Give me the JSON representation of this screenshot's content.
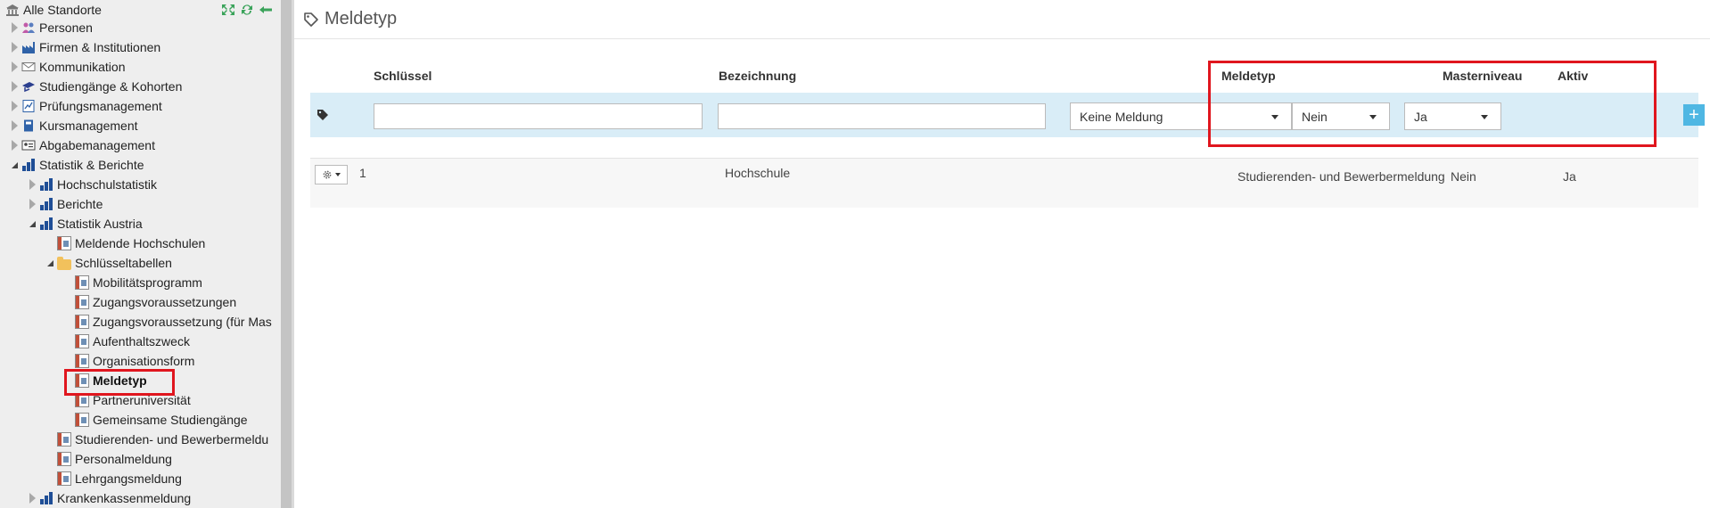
{
  "sidebar": {
    "root": {
      "label": "Alle Standorte",
      "icon": "building-icon"
    },
    "toolbar": [
      {
        "icon": "expand-icon",
        "color": "#3aa35a"
      },
      {
        "icon": "refresh-icon",
        "color": "#3aa35a"
      },
      {
        "icon": "collapse-icon",
        "color": "#3aa35a"
      }
    ],
    "items": [
      {
        "label": "Personen",
        "icon": "people-icon",
        "state": "closed",
        "level": 0
      },
      {
        "label": "Firmen & Institutionen",
        "icon": "factory-icon",
        "state": "closed",
        "level": 0
      },
      {
        "label": "Kommunikation",
        "icon": "envelope-icon",
        "state": "closed",
        "level": 0
      },
      {
        "label": "Studiengänge & Kohorten",
        "icon": "graduation-icon",
        "state": "closed",
        "level": 0
      },
      {
        "label": "Prüfungsmanagement",
        "icon": "chart-paper-icon",
        "state": "closed",
        "level": 0
      },
      {
        "label": "Kursmanagement",
        "icon": "book-icon",
        "state": "closed",
        "level": 0
      },
      {
        "label": "Abgabemanagement",
        "icon": "idcard-icon",
        "state": "closed",
        "level": 0
      },
      {
        "label": "Statistik & Berichte",
        "icon": "bar-chart-icon",
        "state": "open",
        "level": 0
      },
      {
        "label": "Hochschulstatistik",
        "icon": "bar-chart-icon",
        "state": "closed",
        "level": 1
      },
      {
        "label": "Berichte",
        "icon": "bar-chart-icon",
        "state": "closed",
        "level": 1
      },
      {
        "label": "Statistik Austria",
        "icon": "bar-chart-icon",
        "state": "open",
        "level": 1
      },
      {
        "label": "Meldende Hochschulen",
        "icon": "document-icon",
        "state": "leaf",
        "level": 2
      },
      {
        "label": "Schlüsseltabellen",
        "icon": "folder-icon",
        "state": "open",
        "level": 2
      },
      {
        "label": "Mobilitätsprogramm",
        "icon": "document-icon",
        "state": "leaf",
        "level": 3
      },
      {
        "label": "Zugangsvoraussetzungen",
        "icon": "document-icon",
        "state": "leaf",
        "level": 3
      },
      {
        "label": "Zugangsvoraussetzung (für Mas",
        "icon": "document-icon",
        "state": "leaf",
        "level": 3
      },
      {
        "label": "Aufenthaltszweck",
        "icon": "document-icon",
        "state": "leaf",
        "level": 3
      },
      {
        "label": "Organisationsform",
        "icon": "document-icon",
        "state": "leaf",
        "level": 3
      },
      {
        "label": "Meldetyp",
        "icon": "document-icon",
        "state": "leaf",
        "level": 3,
        "selected": true
      },
      {
        "label": "Partneruniversität",
        "icon": "document-icon",
        "state": "leaf",
        "level": 3
      },
      {
        "label": "Gemeinsame Studiengänge",
        "icon": "document-icon",
        "state": "leaf",
        "level": 3
      },
      {
        "label": "Studierenden- und Bewerbermeldu",
        "icon": "document-icon",
        "state": "leaf",
        "level": 2
      },
      {
        "label": "Personalmeldung",
        "icon": "document-icon",
        "state": "leaf",
        "level": 2
      },
      {
        "label": "Lehrgangsmeldung",
        "icon": "document-icon",
        "state": "leaf",
        "level": 2
      },
      {
        "label": "Krankenkassenmeldung",
        "icon": "bar-chart-icon",
        "state": "closed",
        "level": 1
      }
    ]
  },
  "main": {
    "title": "Meldetyp",
    "title_icon": "tag-icon",
    "columns": {
      "key": "Schlüssel",
      "designation": "Bezeichnung",
      "report_type": "Meldetyp",
      "master_level": "Masterniveau",
      "active": "Aktiv"
    },
    "new_row": {
      "icon": "tag-icon",
      "key_value": "",
      "designation_value": "",
      "report_type_value": "Keine Meldung",
      "master_level_value": "Nein",
      "active_value": "Ja",
      "add_label": "+"
    },
    "rows": [
      {
        "key": "1",
        "designation": "Hochschule",
        "report_type": "Studierenden- und Bewerbermeldung",
        "master_level": "Nein",
        "active": "Ja"
      }
    ]
  },
  "colors": {
    "highlight": "#e0161e",
    "input_row_bg": "#d9edf7",
    "add_button": "#4fb7e3",
    "tree_icon_blue": "#1f4e96"
  }
}
